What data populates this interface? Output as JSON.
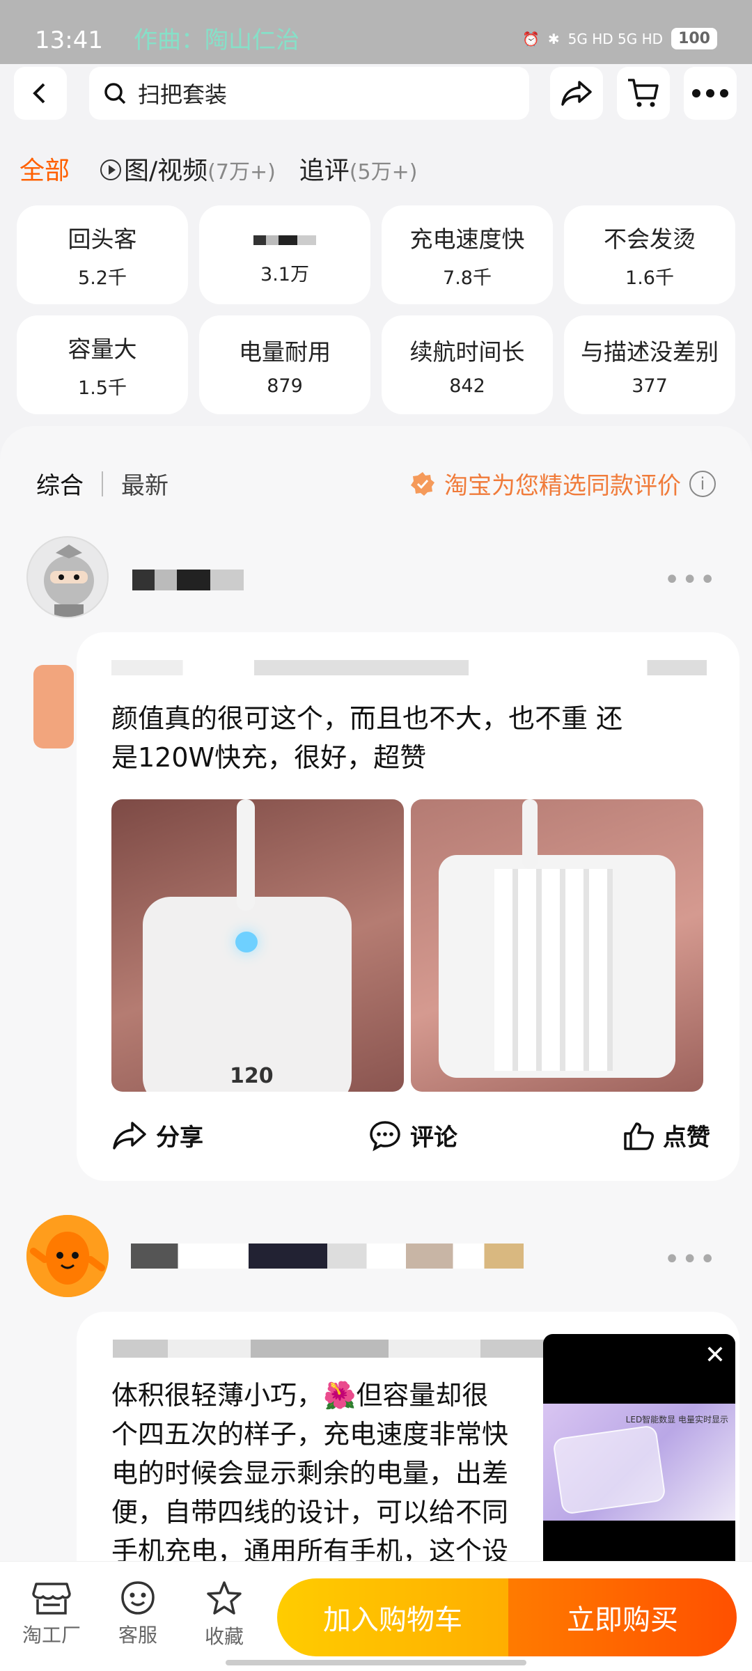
{
  "status_bar": {
    "time": "13:41",
    "song": "作曲：陶山仁治",
    "network": "5G HD 5G HD",
    "battery": "100"
  },
  "search": {
    "query": "扫把套装"
  },
  "filters": {
    "all": "全部",
    "media_label": "图/视频",
    "media_count": "(7万+)",
    "followup_label": "追评",
    "followup_count": "(5万+)"
  },
  "tags": [
    {
      "name": "回头客",
      "count": "5.2千"
    },
    {
      "name": "",
      "count": "3.1万"
    },
    {
      "name": "充电速度快",
      "count": "7.8千"
    },
    {
      "name": "不会发烫",
      "count": "1.6千"
    },
    {
      "name": "容量大",
      "count": "1.5千"
    },
    {
      "name": "电量耐用",
      "count": "879"
    },
    {
      "name": "续航时间长",
      "count": "842"
    },
    {
      "name": "与描述没差别",
      "count": "377"
    }
  ],
  "sort": {
    "comprehensive": "综合",
    "latest": "最新"
  },
  "picked_label": "淘宝为您精选同款评价",
  "reviews": [
    {
      "text_line1": "颜值真的很可这个，而且也不大，也不重 还",
      "text_line2": "是120W快充，很好，超赞",
      "photo1_caption": "120",
      "share": "分享",
      "comment": "评论",
      "like": "点赞"
    },
    {
      "line1": "体积很轻薄小巧，🌺但容量却很",
      "line2": "个四五次的样子，充电速度非常快",
      "line3": "电的时候会显示剩余的电量，出差",
      "line4": "便，自带四线的设计，可以给不同",
      "line5": "手机充电，通用所有手机，这个设"
    }
  ],
  "video": {
    "label": "LED智能数显 电量实时显示",
    "close": "✕"
  },
  "bottom": {
    "factory": "淘工厂",
    "service": "客服",
    "favorite": "收藏",
    "add_cart": "加入购物车",
    "buy_now": "立即购买"
  }
}
